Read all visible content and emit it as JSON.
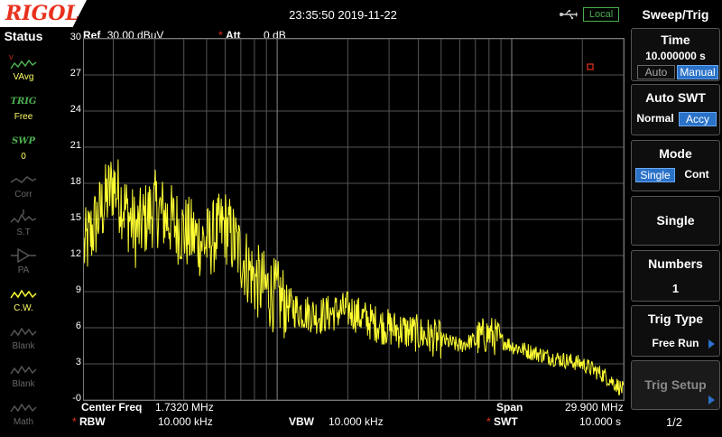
{
  "header": {
    "brand": "RIGOL",
    "datetime": "23:35:50 2019-11-22",
    "remote_status": "Local"
  },
  "status_panel": {
    "title": "Status",
    "items": [
      {
        "top": "V-Avg",
        "label": "VAvg",
        "icon": "trace-avg-icon",
        "state": "active"
      },
      {
        "top": "TRIG",
        "label": "Free",
        "icon": "trig-icon",
        "state": "active"
      },
      {
        "top": "SWP",
        "label": "0",
        "icon": "sweep-icon",
        "state": "active"
      },
      {
        "top": "",
        "label": "Corr",
        "icon": "correction-icon",
        "state": "dim"
      },
      {
        "top": "",
        "label": "S.T",
        "icon": "signal-track-icon",
        "state": "dim"
      },
      {
        "top": "",
        "label": "PA",
        "icon": "preamp-icon",
        "state": "dim"
      },
      {
        "top": "",
        "label": "C.W.",
        "icon": "trace-cw-icon",
        "state": "active"
      },
      {
        "top": "",
        "label": "Blank",
        "icon": "trace-blank-icon",
        "state": "dim"
      },
      {
        "top": "",
        "label": "Blank",
        "icon": "trace-blank-icon",
        "state": "dim"
      },
      {
        "top": "",
        "label": "Math",
        "icon": "trace-math-icon",
        "state": "dim"
      }
    ]
  },
  "measurement": {
    "ref_label": "Ref",
    "ref_value": "30.00 dBuV",
    "att_label": "Att",
    "att_value": "0 dB",
    "center_freq_label": "Center Freq",
    "center_freq_value": "1.7320 MHz",
    "span_label": "Span",
    "span_value": "29.900 MHz",
    "rbw_label": "RBW",
    "rbw_value": "10.000 kHz",
    "vbw_label": "VBW",
    "vbw_value": "10.000 kHz",
    "swt_label": "SWT",
    "swt_value": "10.000 s"
  },
  "y_ticks": [
    "30",
    "27",
    "24",
    "21",
    "18",
    "15",
    "12",
    "9",
    "6",
    "3",
    "-0"
  ],
  "menu": {
    "title": "Sweep/Trig",
    "time": {
      "label": "Time",
      "value": "10.000000 s",
      "auto": "Auto",
      "manual": "Manual"
    },
    "auto_swt": {
      "label": "Auto SWT",
      "normal": "Normal",
      "accy": "Accy"
    },
    "mode": {
      "label": "Mode",
      "single": "Single",
      "cont": "Cont"
    },
    "single": {
      "label": "Single"
    },
    "numbers": {
      "label": "Numbers",
      "value": "1"
    },
    "trig_type": {
      "label": "Trig Type",
      "value": "Free Run"
    },
    "trig_setup": {
      "label": "Trig Setup"
    },
    "page": "1/2"
  },
  "colors": {
    "trace": "#ffff33",
    "accent": "#2a72c8",
    "brand": "#e8311e",
    "local": "#4caf50"
  },
  "chart_data": {
    "type": "line",
    "x_scale": "log",
    "ylim": [
      0,
      30
    ],
    "series": [
      {
        "x": [
          0.15,
          0.2,
          0.25,
          0.3,
          0.4,
          0.5,
          0.6,
          0.8,
          1.0,
          1.2,
          1.5,
          2.0,
          2.5,
          3.0,
          4.0,
          5.0,
          6.0,
          8.0,
          10,
          12,
          15,
          20,
          25,
          30
        ],
        "values": [
          12.5,
          18,
          14,
          16,
          14,
          13,
          14.5,
          10,
          8.5,
          7.5,
          7,
          7.5,
          6.5,
          6,
          5.5,
          5,
          4.5,
          5.5,
          4.5,
          4,
          3.5,
          3,
          2,
          0.8
        ]
      }
    ]
  }
}
